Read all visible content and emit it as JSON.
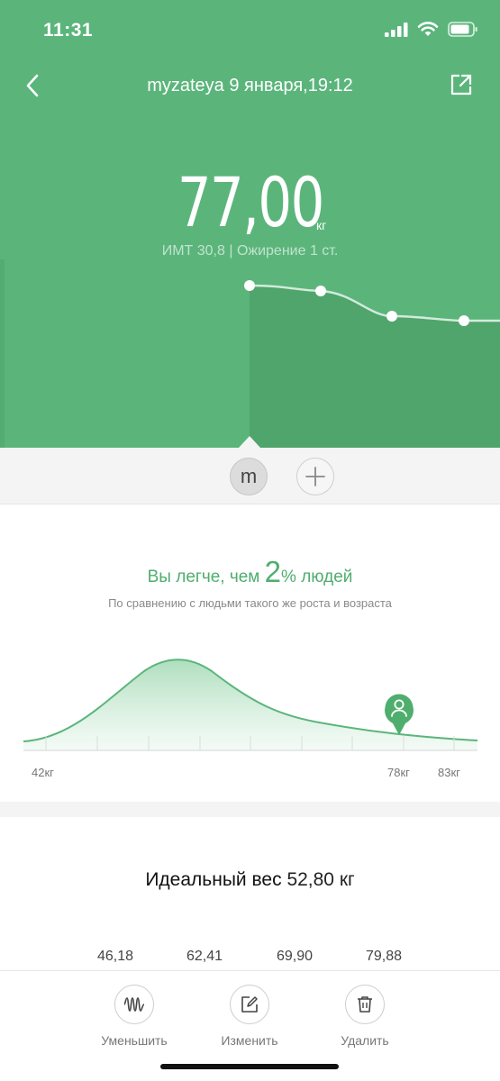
{
  "status_bar": {
    "time": "11:31"
  },
  "header": {
    "title": "myzateya 9 января,19:12"
  },
  "measurement": {
    "weight": "77,00",
    "unit": "кг",
    "bmi_text": "ИМТ 30,8 | Ожирение 1 ст."
  },
  "user_switcher": {
    "current_initial": "m"
  },
  "comparison": {
    "prefix": "Вы легче, чем",
    "percent": "2",
    "suffix": "% людей",
    "caption": "По сравнению с людьми такого же роста и возраста",
    "labels": [
      "42кг",
      "78кг",
      "83кг"
    ]
  },
  "ideal": {
    "label": "Идеальный вес",
    "value": "52,80 кг",
    "ranges": [
      "46,18",
      "62,41",
      "69,90",
      "79,88"
    ]
  },
  "actions": [
    {
      "label": "Уменьшить",
      "icon": "wave-icon"
    },
    {
      "label": "Изменить",
      "icon": "edit-icon"
    },
    {
      "label": "Удалить",
      "icon": "trash-icon"
    }
  ],
  "colors": {
    "brand_green": "#5bb57b",
    "accent_text": "#4fae6e"
  }
}
